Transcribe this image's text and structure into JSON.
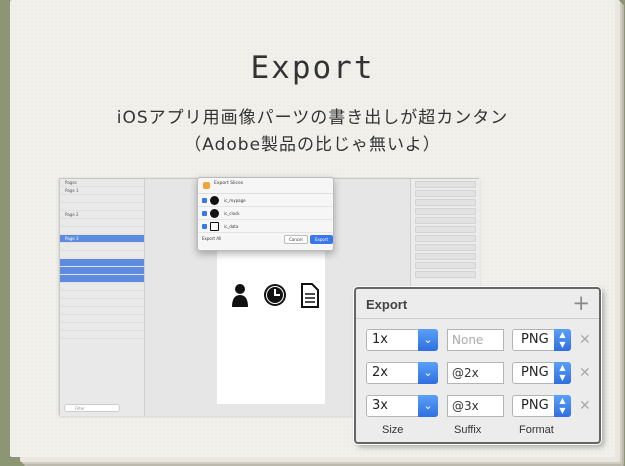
{
  "page": {
    "title": "Export",
    "subtitle_line1": "iOSアプリ用画像パーツの書き出しが超カンタン",
    "subtitle_line2": "（Adobe製品の比じゃ無いよ）"
  },
  "screenshot": {
    "sidebar": {
      "header": "Pages",
      "pages": [
        "Page 1",
        "Page 2",
        "Page 3"
      ]
    },
    "dialog": {
      "title": "Export Slices",
      "items": [
        "ic_mypage",
        "ic_clock",
        "ic_data"
      ],
      "export_all_label": "Export All",
      "cancel": "Cancel",
      "export": "Export"
    },
    "search_placeholder": "Filter"
  },
  "export_panel": {
    "title": "Export",
    "add_label": "+",
    "rows": [
      {
        "size": "1x",
        "suffix": "",
        "suffix_placeholder": "None",
        "format": "PNG"
      },
      {
        "size": "2x",
        "suffix": "@2x",
        "format": "PNG"
      },
      {
        "size": "3x",
        "suffix": "@3x",
        "format": "PNG"
      }
    ],
    "columns": {
      "size": "Size",
      "suffix": "Suffix",
      "format": "Format"
    },
    "remove_label": "✕"
  },
  "colors": {
    "accent": "#3a78e8",
    "page": "#f1f0ea",
    "binding": "#8c9574"
  }
}
